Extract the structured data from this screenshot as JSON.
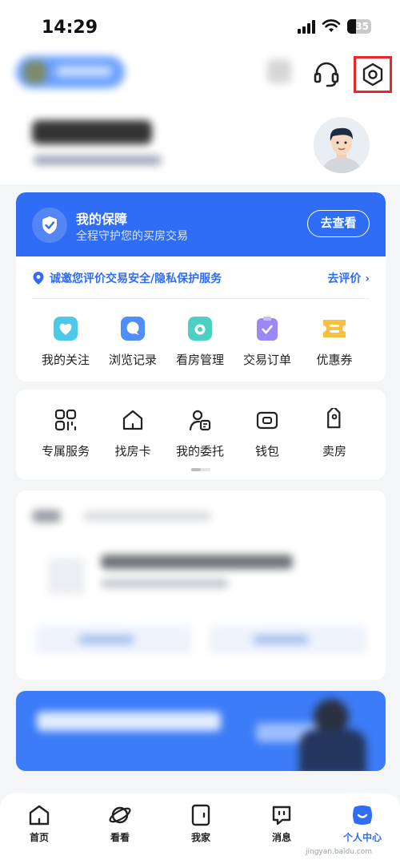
{
  "status_bar": {
    "time": "14:29",
    "battery": "35",
    "battery_level": 0.35
  },
  "header": {
    "headset_icon": "headset-icon",
    "settings_icon": "hexagon-settings-icon"
  },
  "protection": {
    "title": "我的保障",
    "subtitle": "全程守护您的买房交易",
    "check_button": "去查看",
    "evaluation_text": "诚邀您评价交易安全/隐私保护服务",
    "evaluation_link": "去评价",
    "shortcuts": [
      {
        "label": "我的关注",
        "icon": "heart-icon",
        "color": "#4cc9e8"
      },
      {
        "label": "浏览记录",
        "icon": "chat-bubble-icon",
        "color": "#4d8ff7"
      },
      {
        "label": "看房管理",
        "icon": "camera-icon",
        "color": "#4cd0c2"
      },
      {
        "label": "交易订单",
        "icon": "clipboard-check-icon",
        "color": "#9b87f5"
      },
      {
        "label": "优惠券",
        "icon": "ticket-icon",
        "color": "#f6c142"
      }
    ]
  },
  "services": [
    {
      "label": "专属服务",
      "icon": "grid-service-icon"
    },
    {
      "label": "找房卡",
      "icon": "house-card-icon"
    },
    {
      "label": "我的委托",
      "icon": "person-doc-icon"
    },
    {
      "label": "钱包",
      "icon": "wallet-icon"
    },
    {
      "label": "卖房",
      "icon": "price-tag-icon"
    }
  ],
  "bottom_nav": [
    {
      "label": "首页",
      "icon": "home-icon"
    },
    {
      "label": "看看",
      "icon": "planet-icon"
    },
    {
      "label": "我家",
      "icon": "door-icon"
    },
    {
      "label": "消息",
      "icon": "message-icon"
    },
    {
      "label": "个人中心",
      "icon": "smile-face-icon",
      "active": true
    }
  ],
  "colors": {
    "brand_blue": "#2f6df4",
    "highlight_red": "#e8262b"
  },
  "watermark": "jingyan.baidu.com"
}
